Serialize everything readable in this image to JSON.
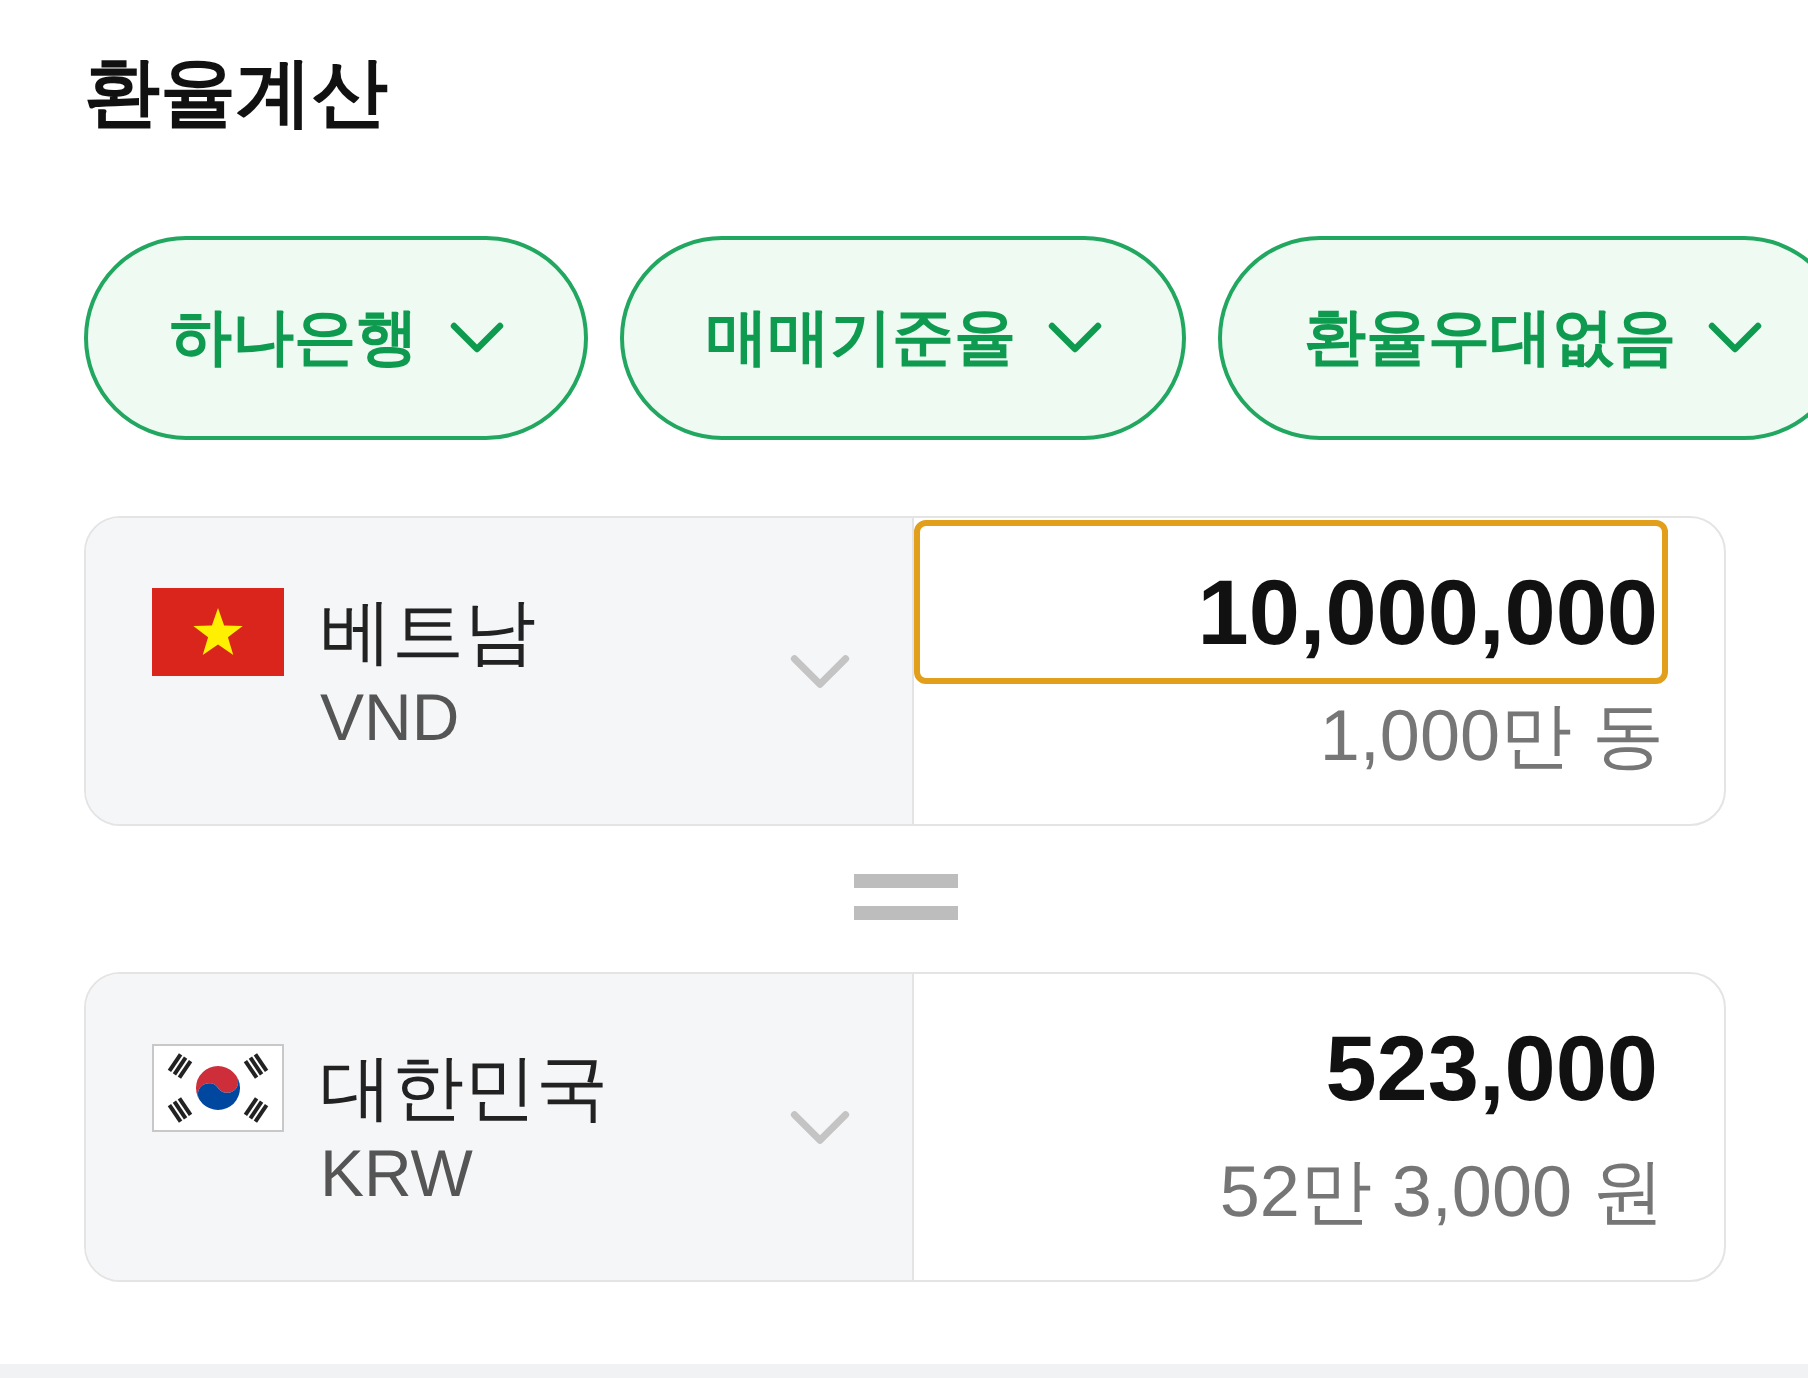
{
  "title": "환율계산",
  "filters": [
    {
      "label": "하나은행"
    },
    {
      "label": "매매기준율"
    },
    {
      "label": "환율우대없음"
    }
  ],
  "conversions": [
    {
      "kind": "vietnam",
      "country": "베트남",
      "code": "VND",
      "amount": "10,000,000",
      "amount_words": "1,000만 동",
      "focused": true
    },
    {
      "kind": "korea",
      "country": "대한민국",
      "code": "KRW",
      "amount": "523,000",
      "amount_words": "52만 3,000 원",
      "focused": false
    }
  ]
}
